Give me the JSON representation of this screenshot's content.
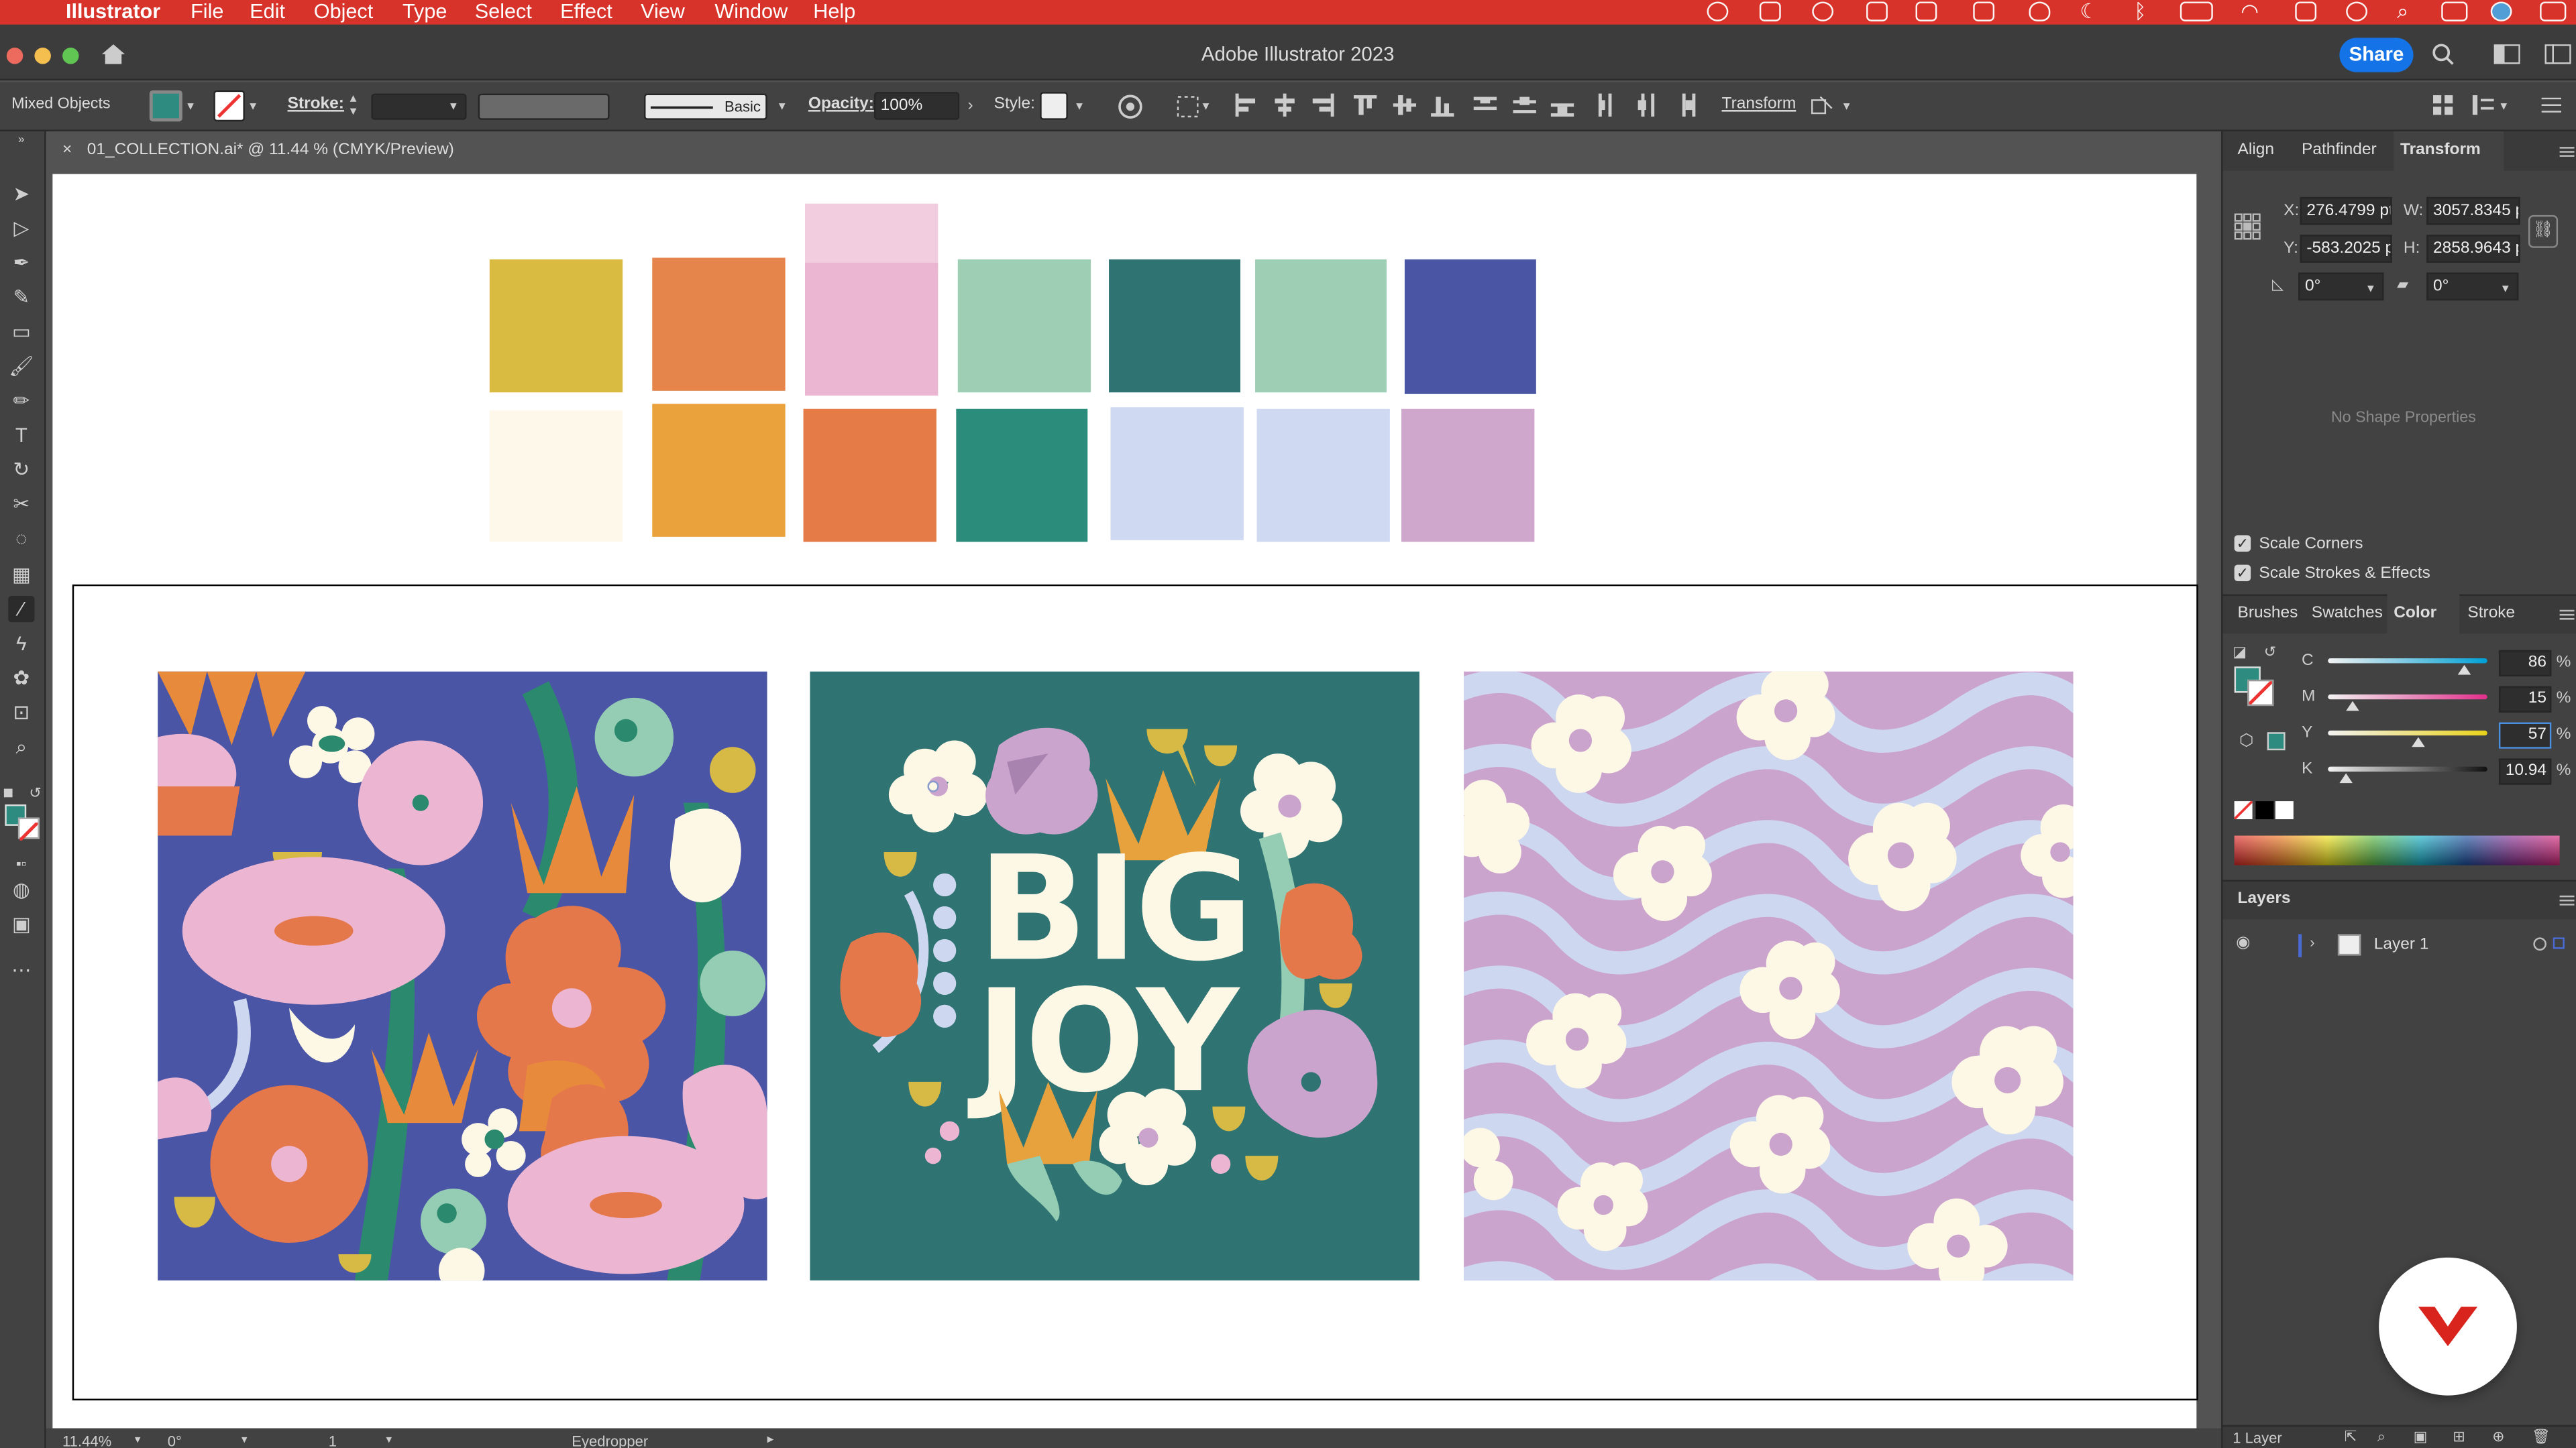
{
  "menubar": {
    "app": "Illustrator",
    "items": [
      "File",
      "Edit",
      "Object",
      "Type",
      "Select",
      "Effect",
      "View",
      "Window",
      "Help"
    ]
  },
  "titlebar": {
    "title": "Adobe Illustrator 2023",
    "share": "Share"
  },
  "control": {
    "selection": "Mixed Objects",
    "stroke_label": "Stroke:",
    "brush": "Basic",
    "opacity_label": "Opacity:",
    "opacity_value": "100%",
    "style_label": "Style:",
    "transform_label": "Transform",
    "fill_color": "#2e8b80"
  },
  "document": {
    "tab": "01_COLLECTION.ai* @ 11.44 % (CMYK/Preview)"
  },
  "swatches": {
    "row1": [
      "#d9bb42",
      "#e5854c",
      "#ebb6d2",
      "#9ecfb5",
      "#2f7373",
      "#9ecfb5",
      "#4a56a3"
    ],
    "row2": [
      "#fdf8ea",
      "#eaa23d",
      "#e57c48",
      "#2b8c7c",
      "#cfd9f1",
      "#cfd9f1",
      "#cfa6cc"
    ],
    "pink_top": "#f2cde0"
  },
  "artwork": {
    "middle_title_line1": "BIG",
    "middle_title_line2": "JOY",
    "colors": {
      "navy": "#4b55a5",
      "teal": "#2f7373",
      "lilac": "#cba4cd",
      "pale_blue": "#cdd8f0",
      "cream": "#fdf7e6",
      "pink": "#ecb6d3",
      "orange": "#e5784a",
      "mustard": "#d7b946",
      "green": "#2b8a6e",
      "mint": "#94cdb3"
    }
  },
  "panels": {
    "top_tabs": [
      "Align",
      "Pathfinder",
      "Transform"
    ],
    "transform": {
      "x_label": "X:",
      "x_value": "276.4799 pt",
      "y_label": "Y:",
      "y_value": "-583.2025 pt",
      "w_label": "W:",
      "w_value": "3057.8345 pt",
      "h_label": "H:",
      "h_value": "2858.9643 pt",
      "angle": "0°",
      "shear": "0°",
      "no_shape": "No Shape Properties",
      "scale_corners": "Scale Corners",
      "scale_strokes": "Scale Strokes & Effects"
    },
    "color_tabs": [
      "Brushes",
      "Swatches",
      "Color",
      "Stroke"
    ],
    "cmyk": [
      {
        "label": "C",
        "value": "86",
        "unit": "%",
        "pos": 0.86,
        "color": "#00a0d6"
      },
      {
        "label": "M",
        "value": "15",
        "unit": "%",
        "pos": 0.15,
        "color": "#e0308a"
      },
      {
        "label": "Y",
        "value": "57",
        "unit": "%",
        "pos": 0.57,
        "color": "#e8d21a"
      },
      {
        "label": "K",
        "value": "10.94",
        "unit": "%",
        "pos": 0.1094,
        "color": "#111111"
      }
    ],
    "layers_title": "Layers",
    "layer_name": "Layer 1",
    "layers_count": "1 Layer"
  },
  "status": {
    "zoom": "11.44%",
    "rotate": "0°",
    "artboard": "1",
    "tool": "Eyedropper"
  }
}
